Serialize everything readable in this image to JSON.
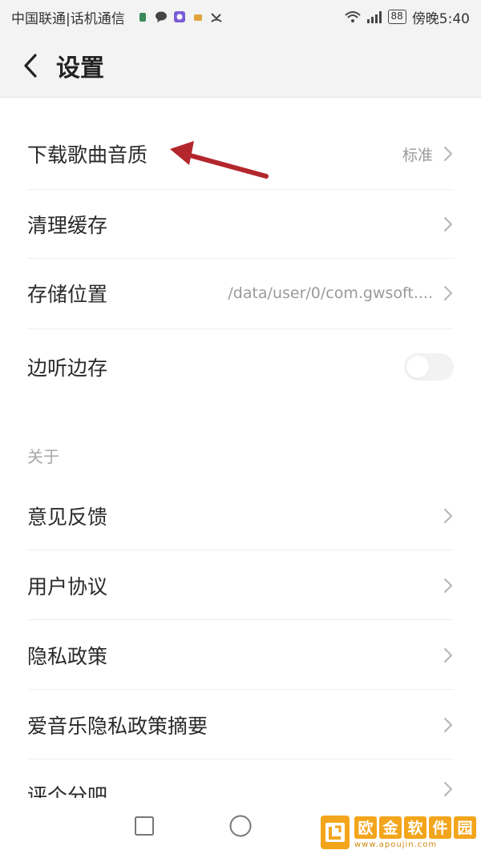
{
  "status_bar": {
    "carrier": "中国联通|话机通信",
    "battery": "88",
    "time": "傍晚5:40"
  },
  "header": {
    "title": "设置"
  },
  "settings": {
    "rows": [
      {
        "label": "下载歌曲音质",
        "value": "标准"
      },
      {
        "label": "清理缓存",
        "value": ""
      },
      {
        "label": "存储位置",
        "value": "/data/user/0/com.gwsoft...."
      },
      {
        "label": "边听边存",
        "toggle_on": false
      }
    ]
  },
  "about": {
    "header": "关于",
    "rows": [
      {
        "label": "意见反馈"
      },
      {
        "label": "用户协议"
      },
      {
        "label": "隐私政策"
      },
      {
        "label": "爱音乐隐私政策摘要"
      },
      {
        "label": "评个分吧"
      }
    ]
  },
  "watermark": {
    "chars": [
      "欧",
      "金",
      "软",
      "件",
      "园"
    ],
    "url": "www.apoujin.com"
  },
  "colors": {
    "annotation_arrow": "#b3262b",
    "watermark_brand": "#f3a51c"
  }
}
